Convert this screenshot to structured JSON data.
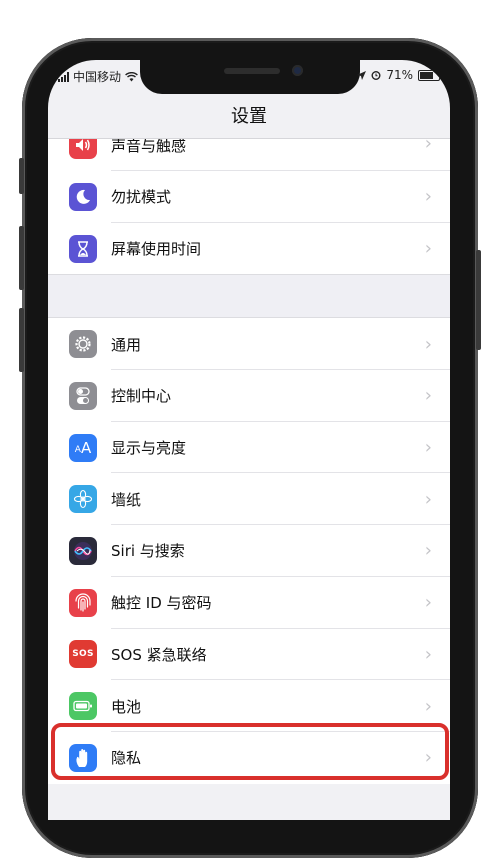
{
  "status": {
    "carrier": "中国移动",
    "battery_pct": "71%",
    "battery_level": 0.71
  },
  "nav": {
    "title": "设置"
  },
  "groups": [
    {
      "items": [
        {
          "label": "声音与触感",
          "icon": "speaker-icon",
          "color": "#e8414a"
        },
        {
          "label": "勿扰模式",
          "icon": "moon-icon",
          "color": "#5b54d4"
        },
        {
          "label": "屏幕使用时间",
          "icon": "hourglass-icon",
          "color": "#5b54d4"
        }
      ]
    },
    {
      "items": [
        {
          "label": "通用",
          "icon": "gear-icon",
          "color": "#8e8e93"
        },
        {
          "label": "控制中心",
          "icon": "toggles-icon",
          "color": "#8e8e93"
        },
        {
          "label": "显示与亮度",
          "icon": "text-size-icon",
          "color": "#2f7cf6",
          "glyph": "AA"
        },
        {
          "label": "墙纸",
          "icon": "flower-icon",
          "color": "#36a7e6"
        },
        {
          "label": "Siri 与搜索",
          "icon": "siri-icon",
          "color": "#2a2a3a"
        },
        {
          "label": "触控 ID 与密码",
          "icon": "fingerprint-icon",
          "color": "#e8414a"
        },
        {
          "label": "SOS 紧急联络",
          "icon": "sos-icon",
          "color": "#e03a32",
          "glyph": "SOS"
        },
        {
          "label": "电池",
          "icon": "battery-icon",
          "color": "#4cc764"
        },
        {
          "label": "隐私",
          "icon": "hand-icon",
          "color": "#2f7cf6"
        }
      ]
    }
  ],
  "chevron": "›",
  "highlight_color": "#d9302c"
}
